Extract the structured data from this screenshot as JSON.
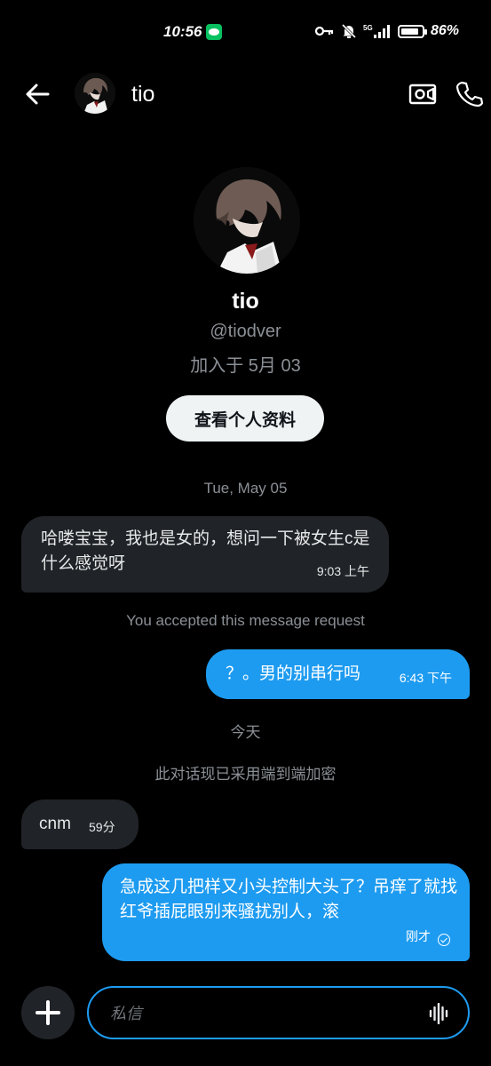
{
  "status_bar": {
    "time": "10:56",
    "battery_text": "86%",
    "battery_level": 0.86,
    "icons": [
      "wechat-icon",
      "key-icon",
      "mute-bell-icon",
      "signal-5g-icon",
      "battery-icon"
    ]
  },
  "header": {
    "name": "tio"
  },
  "profile": {
    "name": "tio",
    "handle": "@tiodver",
    "joined": "加入于 5月 03",
    "view_profile_button": "查看个人资料"
  },
  "messages": {
    "date_1": "Tue, May 05",
    "msg1": {
      "text": "哈喽宝宝，我也是女的，想问一下被女生c是什么感觉呀",
      "time": "9:03 上午"
    },
    "accepted_note": "You accepted this message request",
    "msg2": {
      "text": "？。男的别串行吗",
      "time": "6:43 下午"
    },
    "date_2": "今天",
    "encryption_note": "此对话现已采用端到端加密",
    "msg3": {
      "text": "cnm",
      "time": "59分"
    },
    "msg4": {
      "text": "急成这几把样又小头控制大头了？吊痒了就找红爷插屁眼别来骚扰别人，滚",
      "time": "刚才"
    }
  },
  "composer": {
    "placeholder": "私信"
  },
  "colors": {
    "accent": "#1d9bf0",
    "incoming_bubble": "#202327",
    "background": "#000000",
    "muted_text": "#8b9096"
  }
}
